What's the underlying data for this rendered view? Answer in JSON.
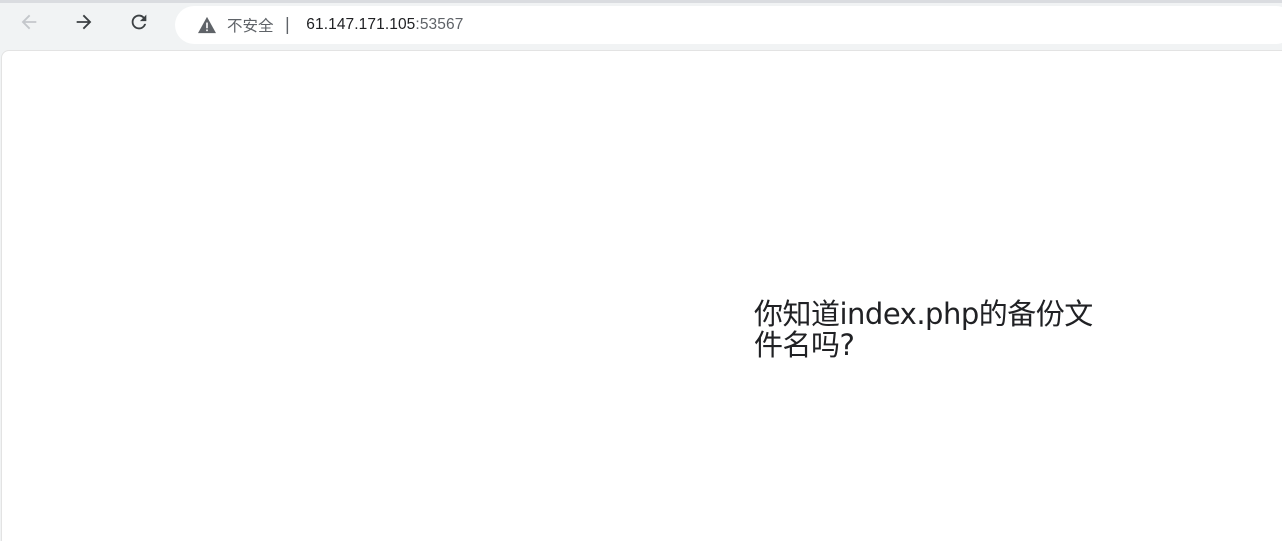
{
  "toolbar": {
    "back_icon": "arrow-left-icon",
    "forward_icon": "arrow-right-icon",
    "reload_icon": "reload-icon"
  },
  "omnibox": {
    "security_icon": "warning-triangle-icon",
    "security_label": "不安全",
    "separator": "|",
    "url_host": "61.147.171.105",
    "url_port": ":53567"
  },
  "page": {
    "message": "你知道index.php的备份文件名吗?"
  },
  "colors": {
    "toolbar_bg": "#f1f3f4",
    "page_bg": "#ffffff",
    "text_primary": "#202124",
    "text_secondary": "#5f6368",
    "disabled_icon": "#bdc1c6"
  }
}
